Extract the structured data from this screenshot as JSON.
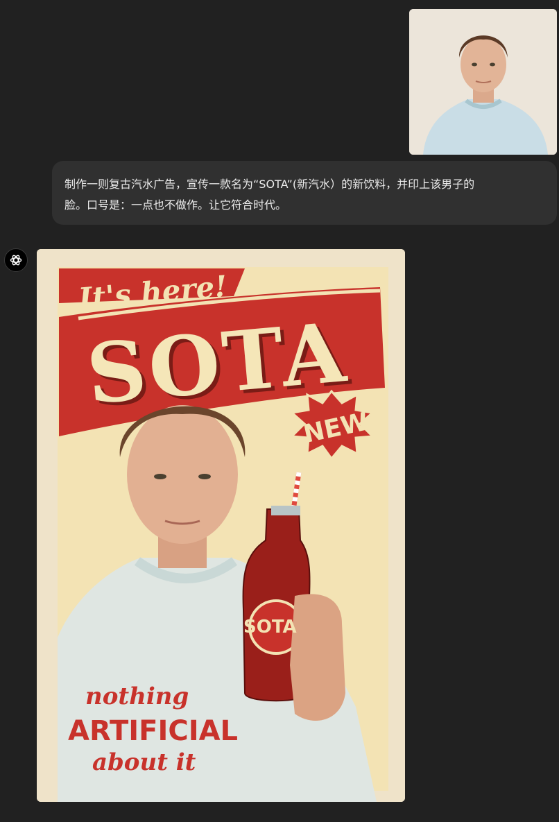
{
  "user_message": {
    "line1": "制作一则复古汽水广告，宣传一款名为“SOTA”(新汽水）的新饮料，并印上该男子的",
    "line2": "脸。口号是：一点也不做作。让它符合时代。"
  },
  "poster": {
    "headline_script": "It's here!",
    "brand": "SOTA",
    "burst": "NEW!",
    "bottle_label": "SOTA",
    "slogan_line1": "nothing",
    "slogan_line2": "ARTIFICIAL",
    "slogan_line3": "about it"
  },
  "colors": {
    "page_bg": "#212121",
    "bubble_bg": "#303030",
    "poster_red": "#c8322b",
    "poster_cream": "#f3e3b4"
  }
}
